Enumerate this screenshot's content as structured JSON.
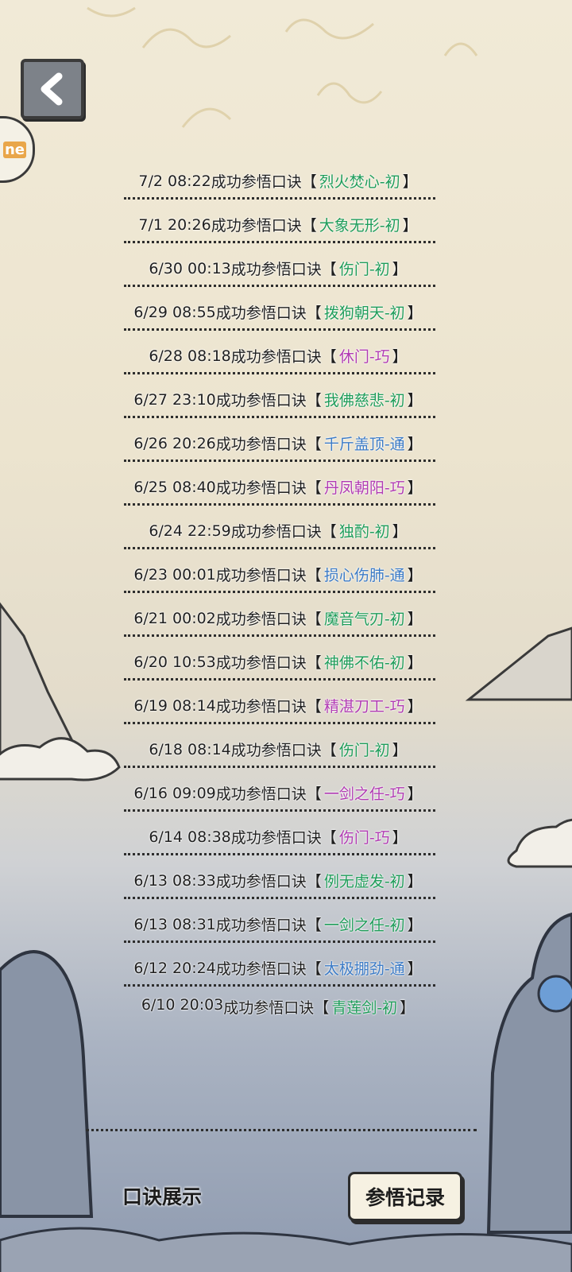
{
  "header": {
    "back_icon": "chevron-left-icon",
    "side_badge_text": "ne"
  },
  "colors": {
    "tier_chu": "#1f9d5a",
    "tier_qiao": "#b13bb3",
    "tier_tong": "#3c7bc6"
  },
  "records": [
    {
      "time": "7/2 08:22",
      "action": "成功参悟口诀",
      "skill": "烈火焚心-初",
      "tier": "初"
    },
    {
      "time": "7/1 20:26",
      "action": "成功参悟口诀",
      "skill": "大象无形-初",
      "tier": "初"
    },
    {
      "time": "6/30 00:13",
      "action": "成功参悟口诀",
      "skill": "伤门-初",
      "tier": "初"
    },
    {
      "time": "6/29 08:55",
      "action": "成功参悟口诀",
      "skill": "拨狗朝天-初",
      "tier": "初"
    },
    {
      "time": "6/28 08:18",
      "action": "成功参悟口诀",
      "skill": "休门-巧",
      "tier": "巧"
    },
    {
      "time": "6/27 23:10",
      "action": "成功参悟口诀",
      "skill": "我佛慈悲-初",
      "tier": "初"
    },
    {
      "time": "6/26 20:26",
      "action": "成功参悟口诀",
      "skill": "千斤盖顶-通",
      "tier": "通"
    },
    {
      "time": "6/25 08:40",
      "action": "成功参悟口诀",
      "skill": "丹凤朝阳-巧",
      "tier": "巧"
    },
    {
      "time": "6/24 22:59",
      "action": "成功参悟口诀",
      "skill": "独酌-初",
      "tier": "初"
    },
    {
      "time": "6/23 00:01",
      "action": "成功参悟口诀",
      "skill": "损心伤肺-通",
      "tier": "通"
    },
    {
      "time": "6/21 00:02",
      "action": "成功参悟口诀",
      "skill": "魔音气刃-初",
      "tier": "初"
    },
    {
      "time": "6/20 10:53",
      "action": "成功参悟口诀",
      "skill": "神佛不佑-初",
      "tier": "初"
    },
    {
      "time": "6/19 08:14",
      "action": "成功参悟口诀",
      "skill": "精湛刀工-巧",
      "tier": "巧"
    },
    {
      "time": "6/18 08:14",
      "action": "成功参悟口诀",
      "skill": "伤门-初",
      "tier": "初"
    },
    {
      "time": "6/16 09:09",
      "action": "成功参悟口诀",
      "skill": "一剑之任-巧",
      "tier": "巧"
    },
    {
      "time": "6/14 08:38",
      "action": "成功参悟口诀",
      "skill": "伤门-巧",
      "tier": "巧"
    },
    {
      "time": "6/13 08:33",
      "action": "成功参悟口诀",
      "skill": "例无虚发-初",
      "tier": "初"
    },
    {
      "time": "6/13 08:31",
      "action": "成功参悟口诀",
      "skill": "一剑之任-初",
      "tier": "初"
    },
    {
      "time": "6/12 20:24",
      "action": "成功参悟口诀",
      "skill": "太极掤劲-通",
      "tier": "通"
    },
    {
      "time": "6/10 20:03",
      "action": "成功参悟口诀",
      "skill": "青莲剑-初",
      "tier": "初"
    }
  ],
  "brackets": {
    "open": "【",
    "close": "】"
  },
  "tabs": {
    "display": "口诀展示",
    "records": "参悟记录"
  }
}
